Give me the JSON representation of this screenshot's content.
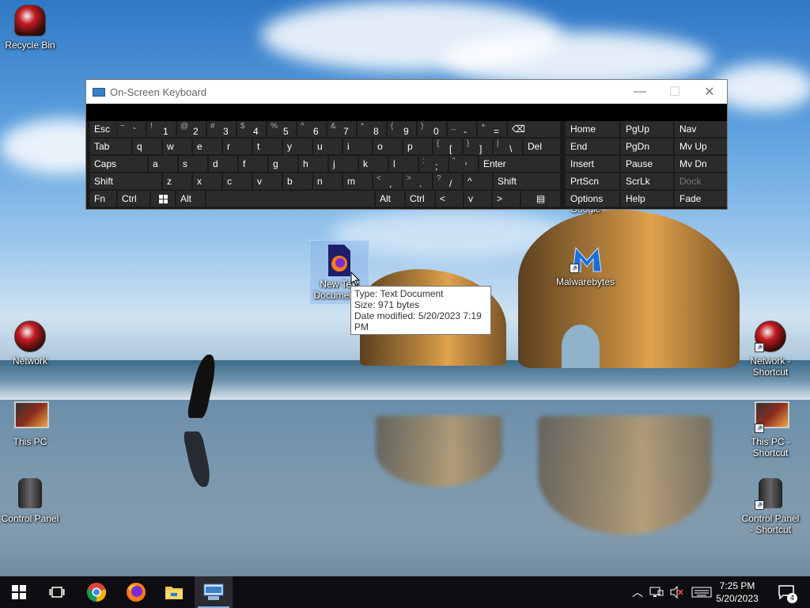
{
  "desktop": {
    "icons_left": [
      {
        "label": "Recycle Bin"
      },
      {
        "label": "Network"
      },
      {
        "label": "This PC"
      },
      {
        "label": "Control Panel"
      }
    ],
    "icons_right": [
      {
        "label": "Network - Shortcut"
      },
      {
        "label": "This PC - Shortcut"
      },
      {
        "label": "Control Panel - Shortcut"
      }
    ],
    "selected_icon": {
      "label": "New Text Document..."
    },
    "malwarebytes": {
      "label": "Malwarebytes"
    },
    "chrome_partial": {
      "label": "Google Chrome"
    }
  },
  "tooltip": {
    "type": "Type: Text Document",
    "size": "Size: 971 bytes",
    "date": "Date modified: 5/20/2023 7:19 PM"
  },
  "osk": {
    "title": "On-Screen Keyboard",
    "row1": [
      {
        "l": "Esc"
      },
      {
        "t": "~",
        "m": "`"
      },
      {
        "t": "!",
        "m": "1"
      },
      {
        "t": "@",
        "m": "2"
      },
      {
        "t": "#",
        "m": "3"
      },
      {
        "t": "$",
        "m": "4"
      },
      {
        "t": "%",
        "m": "5"
      },
      {
        "t": "^",
        "m": "6"
      },
      {
        "t": "&",
        "m": "7"
      },
      {
        "t": "*",
        "m": "8"
      },
      {
        "t": "(",
        "m": "9"
      },
      {
        "t": ")",
        "m": "0"
      },
      {
        "t": "_",
        "m": "-"
      },
      {
        "t": "+",
        "m": "="
      },
      {
        "l": "⌫"
      }
    ],
    "row2": [
      {
        "l": "Tab"
      },
      {
        "l": "q"
      },
      {
        "l": "w"
      },
      {
        "l": "e"
      },
      {
        "l": "r"
      },
      {
        "l": "t"
      },
      {
        "l": "y"
      },
      {
        "l": "u"
      },
      {
        "l": "i"
      },
      {
        "l": "o"
      },
      {
        "l": "p"
      },
      {
        "t": "{",
        "m": "["
      },
      {
        "t": "}",
        "m": "]"
      },
      {
        "t": "|",
        "m": "\\"
      },
      {
        "l": "Del"
      }
    ],
    "row3": [
      {
        "l": "Caps"
      },
      {
        "l": "a"
      },
      {
        "l": "s"
      },
      {
        "l": "d"
      },
      {
        "l": "f"
      },
      {
        "l": "g"
      },
      {
        "l": "h"
      },
      {
        "l": "j"
      },
      {
        "l": "k"
      },
      {
        "l": "l"
      },
      {
        "t": ":",
        "m": ";"
      },
      {
        "t": "\"",
        "m": "'"
      },
      {
        "l": "Enter"
      }
    ],
    "row4": [
      {
        "l": "Shift"
      },
      {
        "l": "z"
      },
      {
        "l": "x"
      },
      {
        "l": "c"
      },
      {
        "l": "v"
      },
      {
        "l": "b"
      },
      {
        "l": "n"
      },
      {
        "l": "m"
      },
      {
        "t": "<",
        "m": ","
      },
      {
        "t": ">",
        "m": "."
      },
      {
        "t": "?",
        "m": "/"
      },
      {
        "l": "^"
      },
      {
        "l": "Shift"
      }
    ],
    "row5": [
      {
        "l": "Fn"
      },
      {
        "l": "Ctrl"
      },
      {
        "l": "win"
      },
      {
        "l": "Alt"
      },
      {
        "l": ""
      },
      {
        "l": "Alt"
      },
      {
        "l": "Ctrl"
      },
      {
        "l": "<"
      },
      {
        "l": "v"
      },
      {
        "l": ">"
      },
      {
        "l": "menu"
      }
    ],
    "nav": [
      [
        "Home",
        "PgUp",
        "Nav"
      ],
      [
        "End",
        "PgDn",
        "Mv Up"
      ],
      [
        "Insert",
        "Pause",
        "Mv Dn"
      ],
      [
        "PrtScn",
        "ScrLk",
        "Dock"
      ],
      [
        "Options",
        "Help",
        "Fade"
      ]
    ]
  },
  "taskbar": {
    "time": "7:25 PM",
    "date": "5/20/2023",
    "notification_count": "4"
  }
}
